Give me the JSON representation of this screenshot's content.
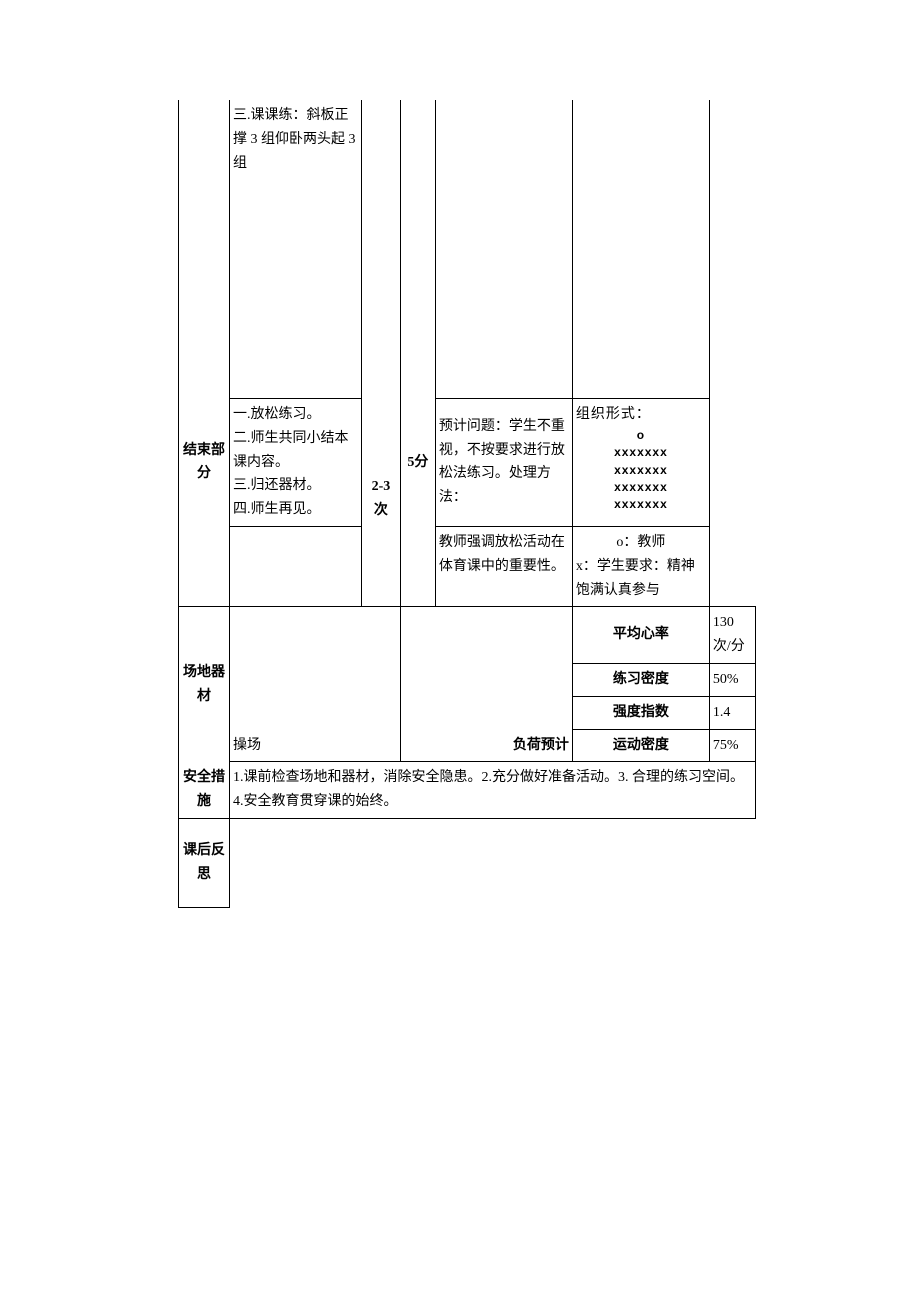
{
  "row1_content": "三.课课练：斜板正撑 3 组仰卧两头起 3 组",
  "conclusion": {
    "label": "结束部分",
    "items": [
      "一.放松练习。",
      "二.师生共同小结本课内容。",
      "三.归还器材。",
      "四.师生再见。"
    ],
    "count_text": "2-3次",
    "time_text": "5分",
    "predicted": "预计问题：学生不重视，不按要求进行放松法练习。处理方法：",
    "organization": {
      "title": "组织形式：",
      "teacher_mark": "o",
      "rows": [
        "xxxxxxx",
        "xxxxxxx",
        "xxxxxxx",
        "xxxxxxx"
      ]
    }
  },
  "row3": {
    "teacher_note": "教师强调放松活动在体育课中的重要性。",
    "legend_teacher": "o：教师",
    "legend_student": "x：学生要求：精神饱满认真参与"
  },
  "venue": {
    "label": "场地器材",
    "value": "操场"
  },
  "load": {
    "label": "负荷预计",
    "metrics": [
      {
        "label": "平均心率",
        "value": "130 次/分"
      },
      {
        "label": "练习密度",
        "value": "50%"
      },
      {
        "label": "强度指数",
        "value": "1.4"
      },
      {
        "label": "运动密度",
        "value": "75%"
      }
    ]
  },
  "safety": {
    "label": "安全措施",
    "value": "1.课前检查场地和器材，消除安全隐患。2.充分做好准备活动。3. 合理的练习空间。4.安全教育贯穿课的始终。"
  },
  "reflection": {
    "label": "课后反思",
    "value": ""
  }
}
